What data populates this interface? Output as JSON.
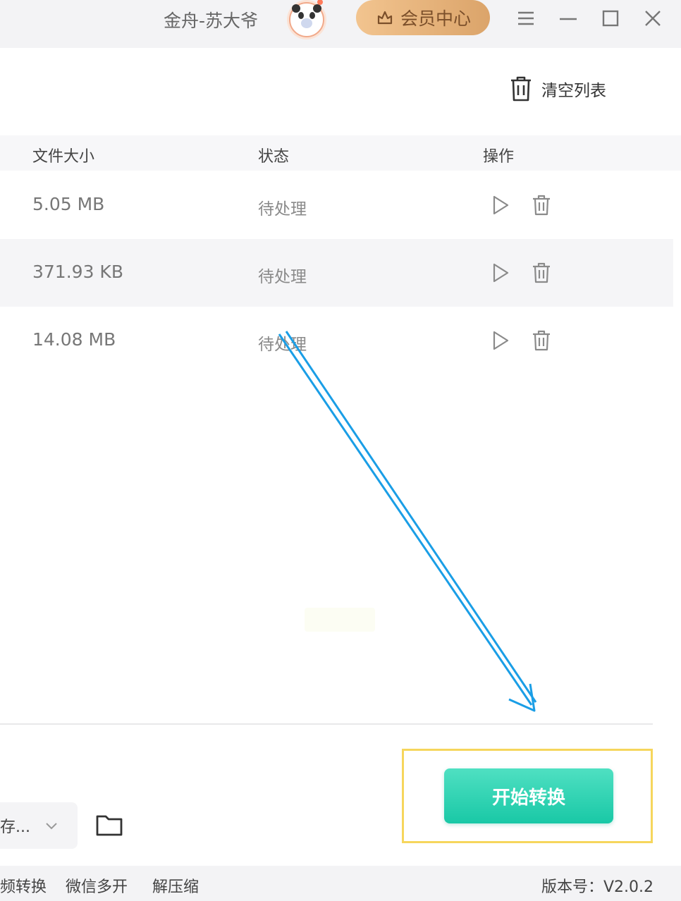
{
  "titlebar": {
    "username": "金舟-苏大爷",
    "vip_label": "会员中心"
  },
  "toolbar": {
    "clear_list": "清空列表"
  },
  "table": {
    "headers": {
      "size": "文件大小",
      "status": "状态",
      "action": "操作"
    },
    "rows": [
      {
        "size": "5.05 MB",
        "status": "待处理"
      },
      {
        "size": "371.93 KB",
        "status": "待处理"
      },
      {
        "size": "14.08 MB",
        "status": "待处理"
      }
    ]
  },
  "output": {
    "select_value": "存..."
  },
  "actions": {
    "start_label": "开始转换"
  },
  "footer": {
    "links": [
      "频转换",
      "微信多开",
      "解压缩"
    ],
    "version": "版本号：V2.0.2"
  },
  "colors": {
    "accent": "#1ec9a7",
    "vip": "#e0aa6e",
    "highlight": "#f6d65c",
    "arrow": "#1a9ee6"
  },
  "icons": [
    "panda-avatar-icon",
    "crown-icon",
    "menu-icon",
    "minimize-icon",
    "maximize-icon",
    "close-icon",
    "trash-icon",
    "play-icon",
    "chevron-down-icon",
    "folder-icon"
  ]
}
